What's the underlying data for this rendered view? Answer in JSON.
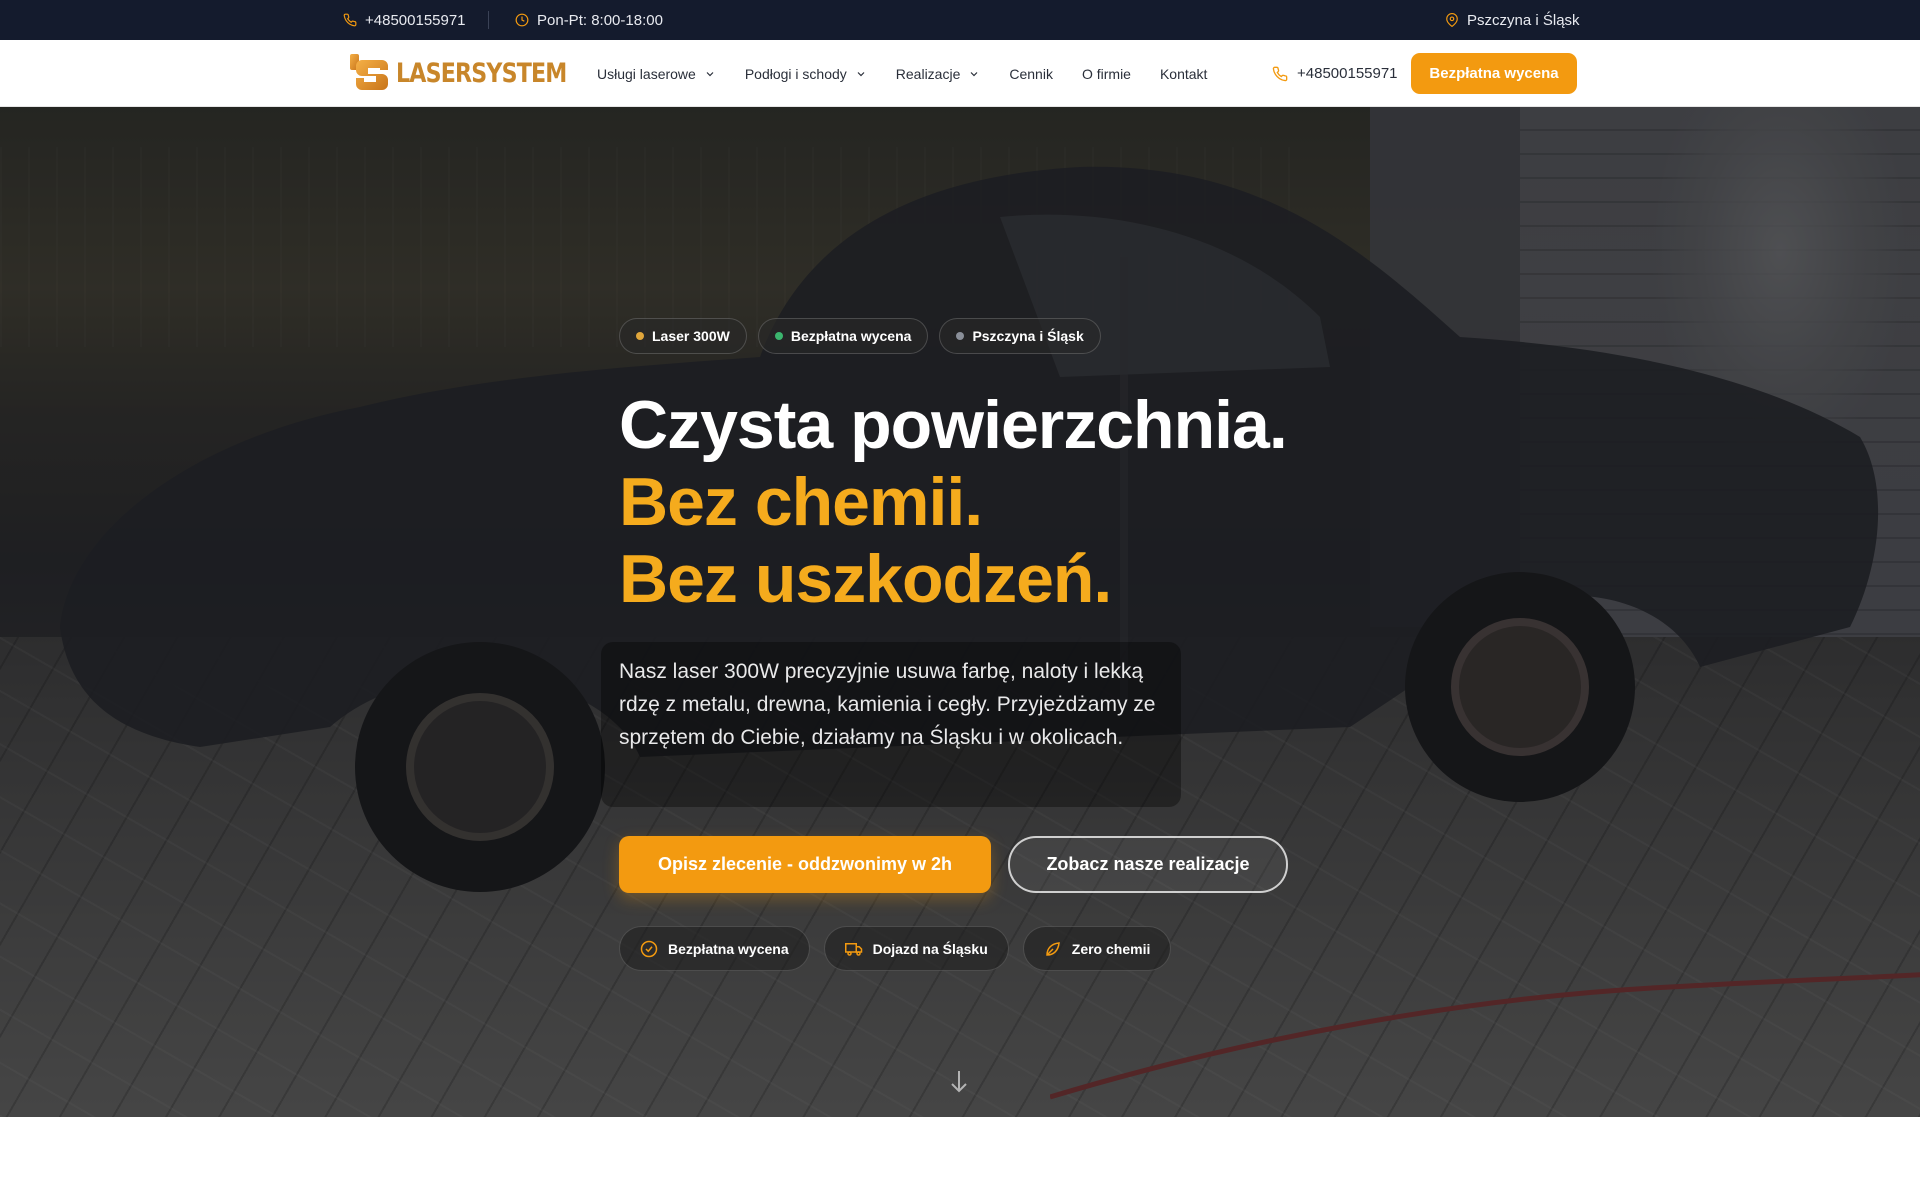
{
  "topbar": {
    "phone": "+48500155971",
    "hours": "Pon-Pt: 8:00-18:00",
    "location": "Pszczyna i Śląsk",
    "phone_icon": "phone-icon",
    "clock_icon": "clock-icon",
    "pin_icon": "map-pin-icon"
  },
  "nav": {
    "logo_text": "LASERSYSTEM",
    "links": [
      {
        "label": "Usługi laserowe",
        "dropdown": true
      },
      {
        "label": "Podłogi i schody",
        "dropdown": true
      },
      {
        "label": "Realizacje",
        "dropdown": true
      },
      {
        "label": "Cennik",
        "dropdown": false
      },
      {
        "label": "O firmie",
        "dropdown": false
      },
      {
        "label": "Kontakt",
        "dropdown": false
      }
    ],
    "phone": "+48500155971",
    "cta": "Bezpłatna wycena"
  },
  "hero": {
    "pills": [
      {
        "label": "Laser 300W",
        "dot_color": "#e0a63b"
      },
      {
        "label": "Bezpłatna wycena",
        "dot_color": "#3bb56e"
      },
      {
        "label": "Pszczyna i Śląsk",
        "dot_color": "#8a8f99"
      }
    ],
    "headline": {
      "line1": "Czysta powierzchnia.",
      "line2": "Bez chemii.",
      "line3": "Bez uszkodzeń."
    },
    "description": "Nasz laser 300W precyzyjnie usuwa farbę, naloty i lekką rdzę z metalu, drewna, kamienia i cegły. Przyjeżdżamy ze sprzętem do Ciebie, działamy na Śląsku i w okolicach.",
    "primary_button": "Opisz zlecenie - oddzwonimy w 2h",
    "secondary_button": "Zobacz nasze realizacje",
    "features": [
      {
        "label": "Bezpłatna wycena",
        "icon": "check-circle-icon"
      },
      {
        "label": "Dojazd na Śląsku",
        "icon": "truck-icon"
      },
      {
        "label": "Zero chemii",
        "icon": "leaf-icon"
      }
    ]
  },
  "colors": {
    "accent": "#f39a10",
    "accent_text": "#f5ab1d",
    "topbar_bg": "#141b2d"
  }
}
